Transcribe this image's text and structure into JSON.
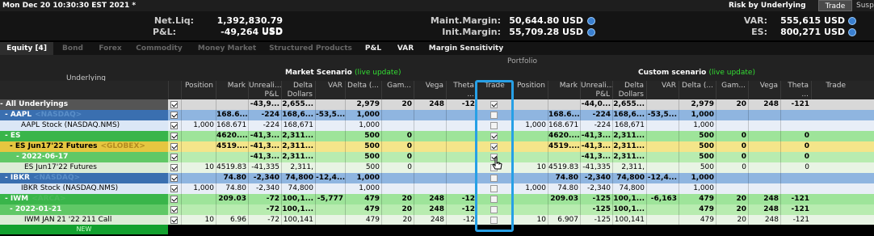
{
  "topbar": {
    "datetime": "Mon Dec 20 10:30:30 EST 2021 *",
    "risk_by": "Risk by Underlying",
    "trade_btn": "Trade",
    "susp": "Susp"
  },
  "header": {
    "netliq_label": "Net.Liq:",
    "netliq_value": "1,392,830.79 USD",
    "pl_label": "P&L:",
    "pl_value": "-49,264 USD",
    "maint_label": "Maint.Margin:",
    "maint_value": "50,644.80 USD",
    "init_label": "Init.Margin:",
    "init_value": "55,709.28 USD",
    "var_label": "VAR:",
    "var_value": "555,615 USD",
    "es_label": "ES:",
    "es_value": "800,271 USD"
  },
  "tabs": [
    "Equity [4]",
    "Bond",
    "Forex",
    "Commodity",
    "Money Market",
    "Structured Products",
    "P&L",
    "VAR",
    "Margin Sensitivity"
  ],
  "grid": {
    "portfolio": "Portfolio",
    "underlying": "Underlying",
    "market_scenario": "Market Scenario",
    "custom_scenario": "Custom scenario",
    "live_update": "(live update)",
    "cols_left": [
      "Position",
      "Mark",
      "Unreali... P&L",
      "Delta Dollars",
      "VAR",
      "Delta (...",
      "Gam...",
      "Vega",
      "Theta ...",
      "Trade"
    ],
    "cols_right": [
      "Position",
      "Mark",
      "Unreali... P&L",
      "Delta Dollars",
      "VAR",
      "Delta (...",
      "Gam...",
      "Vega",
      "Theta ...",
      "Trade"
    ]
  },
  "rows": [
    {
      "name": "- All Underlyings",
      "tag": "",
      "pos": "",
      "mark": "",
      "upl": "-43,9...",
      "dd": "2,655...",
      "var": "",
      "delta": "2,979",
      "gam": "20",
      "vega": "248",
      "theta": "-12",
      "trade": true,
      "rpos": "",
      "rmark": "",
      "rupl": "-44,0...",
      "rdd": "2,655...",
      "rvar": "",
      "rdelta": "2,979",
      "rgam": "20",
      "rvega": "248",
      "rtheta": "-121"
    },
    {
      "name": "- AAPL",
      "tag": "<NASDAQ>",
      "pos": "",
      "mark": "168.6...",
      "upl": "-224",
      "dd": "168,6...",
      "var": "-53,5...",
      "delta": "1,000",
      "gam": "",
      "vega": "",
      "theta": "",
      "trade": false,
      "rpos": "",
      "rmark": "168.6...",
      "rupl": "-224",
      "rdd": "168,6...",
      "rvar": "-53,5...",
      "rdelta": "1,000",
      "rgam": "",
      "rvega": "",
      "rtheta": ""
    },
    {
      "name": "AAPL Stock (NASDAQ.NMS)",
      "tag": "",
      "pos": "1,000",
      "mark": "168.671",
      "upl": "-224",
      "dd": "168,671",
      "var": "",
      "delta": "1,000",
      "gam": "",
      "vega": "",
      "theta": "",
      "trade": false,
      "rpos": "1,000",
      "rmark": "168.671",
      "rupl": "-224",
      "rdd": "168,671",
      "rvar": "",
      "rdelta": "1,000",
      "rgam": "",
      "rvega": "",
      "rtheta": ""
    },
    {
      "name": "- ES",
      "tag": "",
      "pos": "",
      "mark": "4620....",
      "upl": "-41,3...",
      "dd": "2,311...",
      "var": "",
      "delta": "500",
      "gam": "0",
      "vega": "",
      "theta": "",
      "trade": true,
      "rpos": "",
      "rmark": "4620....",
      "rupl": "-41,3...",
      "rdd": "2,311...",
      "rvar": "",
      "rdelta": "500",
      "rgam": "0",
      "rvega": "",
      "rtheta": "0"
    },
    {
      "name": "- ES Jun17'22 Futures",
      "tag": "<GLOBEX>",
      "pos": "",
      "mark": "4519....",
      "upl": "-41,3...",
      "dd": "2,311...",
      "var": "",
      "delta": "500",
      "gam": "0",
      "vega": "",
      "theta": "",
      "trade": true,
      "rpos": "",
      "rmark": "4519....",
      "rupl": "-41,3...",
      "rdd": "2,311...",
      "rvar": "",
      "rdelta": "500",
      "rgam": "0",
      "rvega": "",
      "rtheta": "0"
    },
    {
      "name": "- 2022-06-17",
      "tag": "",
      "pos": "",
      "mark": "",
      "upl": "-41,3...",
      "dd": "2,311...",
      "var": "",
      "delta": "500",
      "gam": "0",
      "vega": "",
      "theta": "",
      "trade": true,
      "rpos": "",
      "rmark": "",
      "rupl": "-41,3...",
      "rdd": "2,311...",
      "rvar": "",
      "rdelta": "500",
      "rgam": "0",
      "rvega": "",
      "rtheta": "0"
    },
    {
      "name": "ES Jun17'22 Futures",
      "tag": "",
      "pos": "10",
      "mark": "4519.83",
      "upl": "-41,335",
      "dd": "2,311,",
      "var": "",
      "delta": "500",
      "gam": "0",
      "vega": "",
      "theta": "",
      "trade": false,
      "rpos": "10",
      "rmark": "4519.83",
      "rupl": "-41,335",
      "rdd": "2,311,",
      "rvar": "",
      "rdelta": "500",
      "rgam": "0",
      "rvega": "",
      "rtheta": "0"
    },
    {
      "name": "- IBKR",
      "tag": "<NASDAQ>",
      "pos": "",
      "mark": "74.80",
      "upl": "-2,340",
      "dd": "74,800",
      "var": "-12,4...",
      "delta": "1,000",
      "gam": "",
      "vega": "",
      "theta": "",
      "trade": false,
      "rpos": "",
      "rmark": "74.80",
      "rupl": "-2,340",
      "rdd": "74,800",
      "rvar": "-12,4...",
      "rdelta": "1,000",
      "rgam": "",
      "rvega": "",
      "rtheta": ""
    },
    {
      "name": "IBKR Stock (NASDAQ.NMS)",
      "tag": "",
      "pos": "1,000",
      "mark": "74.80",
      "upl": "-2,340",
      "dd": "74,800",
      "var": "",
      "delta": "1,000",
      "gam": "",
      "vega": "",
      "theta": "",
      "trade": false,
      "rpos": "1,000",
      "rmark": "74.80",
      "rupl": "-2,340",
      "rdd": "74,800",
      "rvar": "",
      "rdelta": "1,000",
      "rgam": "",
      "rvega": "",
      "rtheta": ""
    },
    {
      "name": "- IWM",
      "tag": "<ARCA>",
      "pos": "",
      "mark": "209.03",
      "upl": "-72",
      "dd": "100,1...",
      "var": "-5,777",
      "delta": "479",
      "gam": "20",
      "vega": "248",
      "theta": "-12",
      "trade": false,
      "rpos": "",
      "rmark": "209.03",
      "rupl": "-125",
      "rdd": "100,1...",
      "rvar": "-6,163",
      "rdelta": "479",
      "rgam": "20",
      "rvega": "248",
      "rtheta": "-121"
    },
    {
      "name": "- 2022-01-21",
      "tag": "",
      "pos": "",
      "mark": "",
      "upl": "-72",
      "dd": "100,1...",
      "var": "",
      "delta": "479",
      "gam": "20",
      "vega": "248",
      "theta": "-12",
      "trade": false,
      "rpos": "",
      "rmark": "",
      "rupl": "-125",
      "rdd": "100,1...",
      "rvar": "",
      "rdelta": "479",
      "rgam": "20",
      "rvega": "248",
      "rtheta": "-121"
    },
    {
      "name": "IWM JAN 21 '22 211 Call",
      "tag": "",
      "pos": "10",
      "mark": "6.96",
      "upl": "-72",
      "dd": "100,141",
      "var": "",
      "delta": "479",
      "gam": "20",
      "vega": "248",
      "theta": "-12",
      "trade": false,
      "rpos": "10",
      "rmark": "6.907",
      "rupl": "-125",
      "rdd": "100,141",
      "rvar": "",
      "rdelta": "479",
      "rgam": "20",
      "rvega": "248",
      "rtheta": "-121"
    }
  ],
  "new_label": "NEW",
  "colors": {
    "highlight": "#27a0e6",
    "live": "#33dd33"
  }
}
